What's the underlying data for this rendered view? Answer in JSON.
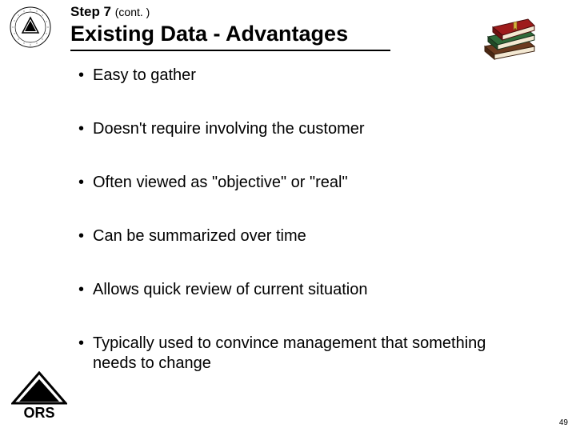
{
  "header": {
    "step_label": "Step 7 ",
    "cont_label": "(cont. )",
    "title": "Existing Data - Advantages"
  },
  "bullets": [
    "Easy to gather",
    "Doesn't require involving the customer",
    "Often viewed as \"objective\" or \"real\"",
    "Can be summarized over time",
    "Allows quick review of current situation",
    "Typically used to convince management that something needs to change"
  ],
  "logos": {
    "nih_alt": "NIH seal",
    "ors_text": "ORS"
  },
  "page_number": "49"
}
